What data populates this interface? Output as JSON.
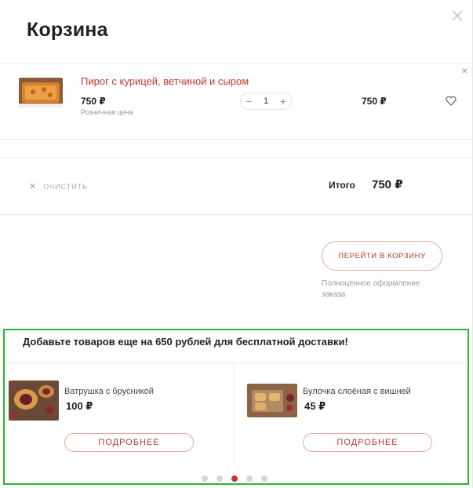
{
  "modal": {
    "title": "Корзина"
  },
  "cart_item": {
    "name": "Пирог с курицей, ветчиной и сыром",
    "price": "750 ₽",
    "price_note": "Розничная цена",
    "quantity": "1",
    "total": "750 ₽"
  },
  "summary": {
    "clear_label": "очистить",
    "total_label": "Итого",
    "total_value": "750 ₽"
  },
  "checkout": {
    "button_label": "ПЕРЕЙТИ В КОРЗИНУ",
    "note": "Полноценное оформление заказа"
  },
  "recommendations": {
    "title": "Добавьте товаров еще на 650 рублей для бесплатной доставки!",
    "items": [
      {
        "name": "Ватрушка с брусникой",
        "price": "100 ₽",
        "button_label": "ПОДРОБНЕЕ"
      },
      {
        "name": "Булочка слоёная с вишней",
        "price": "45 ₽",
        "button_label": "ПОДРОБНЕЕ"
      }
    ],
    "pagination": {
      "total": 5,
      "active_index": 2
    }
  },
  "colors": {
    "accent": "#c0392b",
    "highlight_border": "#2fb52f"
  },
  "icons": [
    "close-icon",
    "heart-icon",
    "minus-icon",
    "plus-icon",
    "remove-icon"
  ]
}
